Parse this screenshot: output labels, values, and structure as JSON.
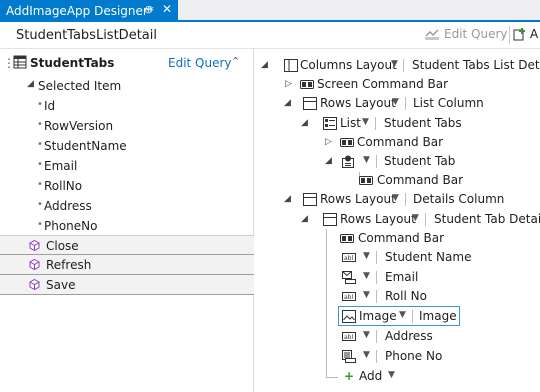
{
  "tab": {
    "title": "AddImageApp Designer*",
    "pin_glyph": "⊕",
    "close_glyph": "✕"
  },
  "header": {
    "screen_title": "StudentTabsListDetail",
    "edit_query": "Edit Query",
    "add_label": "A"
  },
  "left": {
    "root_label": "StudentTabs",
    "edit_query": "Edit Query",
    "selected_item": "Selected Item",
    "fields": [
      "Id",
      "RowVersion",
      "StudentName",
      "Email",
      "RollNo",
      "Address",
      "PhoneNo"
    ],
    "commands": [
      "Close",
      "Refresh",
      "Save"
    ]
  },
  "designer": {
    "columns_layout": "Columns Layout",
    "screen_name": "Student Tabs List Detail",
    "screen_command_bar": "Screen Command Bar",
    "rows_layout_1": "Rows Layout",
    "list_column": "List Column",
    "list": "List",
    "student_tabs": "Student Tabs",
    "command_bar_1": "Command Bar",
    "student_tab": "Student Tab",
    "command_bar_2": "Command Bar",
    "rows_layout_2": "Rows Layout",
    "details_column": "Details Column",
    "rows_layout_3": "Rows Layout",
    "student_tab_details": "Student Tab Details",
    "command_bar_3": "Command Bar",
    "student_name": "Student Name",
    "email": "Email",
    "roll_no": "Roll No",
    "image_control": "Image",
    "image_field": "Image",
    "address": "Address",
    "phone_no": "Phone No",
    "add": "Add"
  },
  "colors": {
    "accent": "#007acc",
    "link": "#0e70c0",
    "command_icon": "#8a3fbf",
    "add_plus": "#2e9a2e"
  }
}
